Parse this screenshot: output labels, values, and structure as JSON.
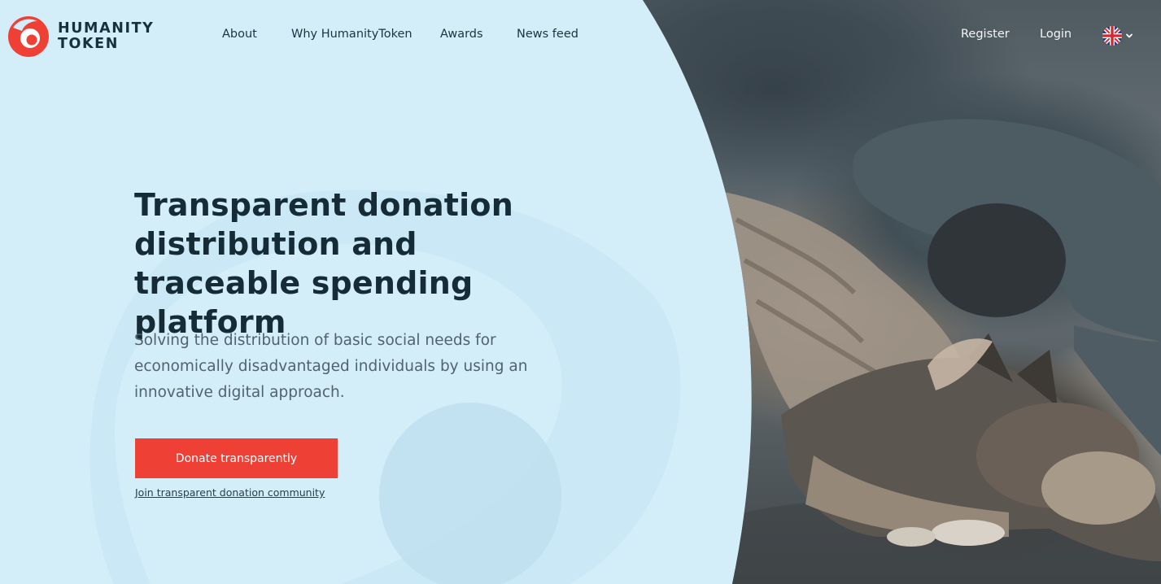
{
  "brand": {
    "line1": "HUMANITY",
    "line2": "TOKEN",
    "accent_color": "#ee4035"
  },
  "nav": {
    "items": [
      {
        "label": "About"
      },
      {
        "label": "Why HumanityToken"
      },
      {
        "label": "Awards"
      },
      {
        "label": "News feed"
      }
    ]
  },
  "auth": {
    "register_label": "Register",
    "login_label": "Login"
  },
  "language": {
    "icon": "uk-flag-icon",
    "dropdown_icon": "chevron-down-icon"
  },
  "hero": {
    "headline": "Transparent donation distribution and traceable spending platform",
    "subtext": "Solving the distribution of basic social needs for economically disadvantaged individuals by using an innovative digital approach.",
    "cta_label": "Donate transparently",
    "secondary_link": "Join transparent donation community",
    "background_color": "#d3edf9"
  }
}
